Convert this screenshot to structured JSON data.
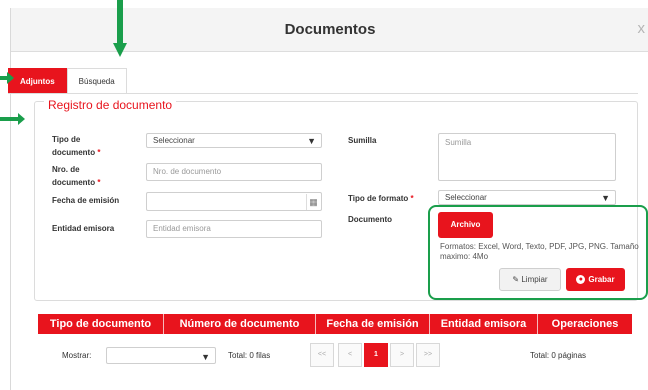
{
  "modal": {
    "title": "Documentos",
    "close_label": "x"
  },
  "tabs": [
    {
      "label": "Adjuntos",
      "active": true
    },
    {
      "label": "Búsqueda",
      "active": false
    }
  ],
  "form": {
    "legend": "Registro de documento",
    "tipo_documento": {
      "label_line1": "Tipo de",
      "label_line2": "documento",
      "required_mark": "*",
      "value": "Seleccionar"
    },
    "nro_documento": {
      "label_line1": "Nro. de",
      "label_line2": "documento",
      "required_mark": "*",
      "placeholder": "Nro. de documento"
    },
    "fecha_emision": {
      "label": "Fecha de emisión",
      "value": ""
    },
    "entidad_emisora": {
      "label": "Entidad emisora",
      "placeholder": "Entidad emisora"
    },
    "sumilla": {
      "label": "Sumilla",
      "placeholder": "Sumilla"
    },
    "tipo_formato": {
      "label": "Tipo de formato",
      "required_mark": "*",
      "value": "Seleccionar"
    },
    "documento": {
      "label": "Documento"
    },
    "archivo_button": "Archivo",
    "formats_note": "Formatos: Excel, Word, Texto, PDF, JPG, PNG. Tamaño maximo: 4Mo",
    "limpiar_button": "Limpiar",
    "grabar_button": "Grabar"
  },
  "table": {
    "columns": [
      "Tipo de documento",
      "Número de documento",
      "Fecha de emisión",
      "Entidad emisora",
      "Operaciones"
    ]
  },
  "footer": {
    "mostrar_label": "Mostrar:",
    "mostrar_value": "",
    "total_filas": "Total: 0 filas",
    "current_page": "1",
    "first": "<<",
    "prev": "<",
    "next": ">",
    "last": ">>",
    "total_paginas": "Total: 0 páginas"
  },
  "colors": {
    "accent": "#e8141d",
    "annotation": "#1a9e4b"
  },
  "icons": {
    "calendar": "calendar-icon",
    "caret": "chevron-down-icon",
    "eraser": "eraser-icon",
    "save": "save-icon"
  }
}
